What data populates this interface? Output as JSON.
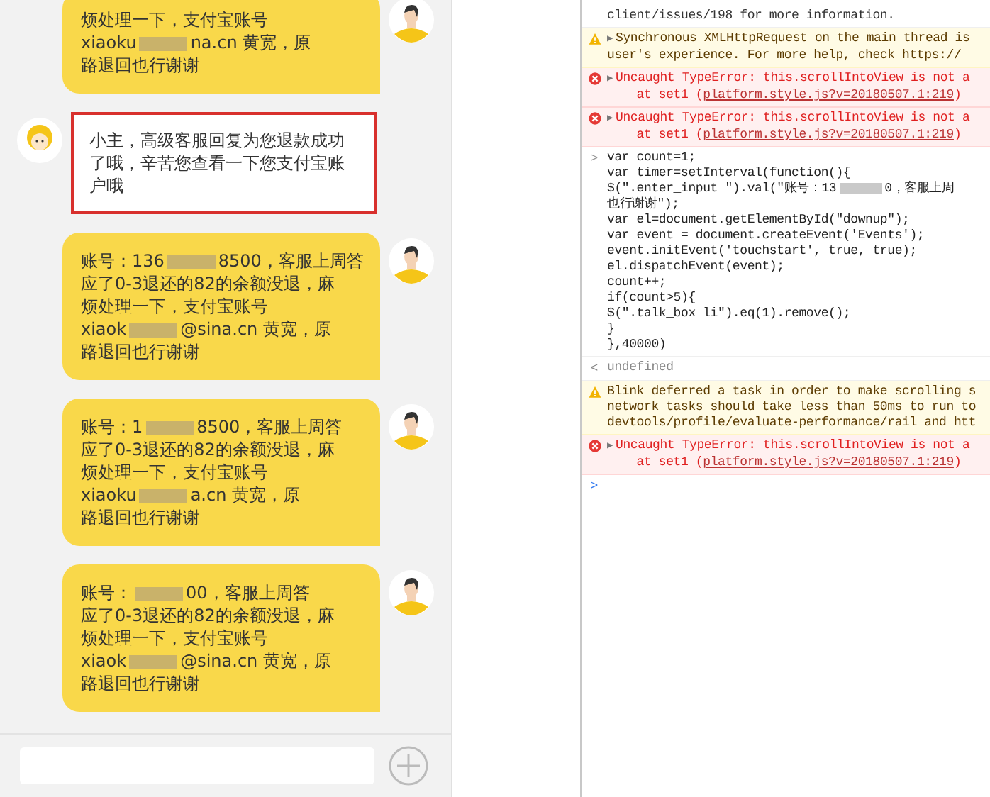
{
  "chat": {
    "messages": [
      {
        "kind": "user",
        "highlighted": false,
        "lines": [
          [
            {
              "kind": "text",
              "text": "烦处理一下，支付宝账号"
            }
          ],
          [
            {
              "kind": "text",
              "text": "xiaoku"
            },
            {
              "kind": "redacted"
            },
            {
              "kind": "text",
              "text": "na.cn 黄宽，原"
            }
          ],
          [
            {
              "kind": "text",
              "text": "路退回也行谢谢"
            }
          ]
        ]
      },
      {
        "kind": "agent",
        "highlighted": true,
        "lines": [
          [
            {
              "kind": "text",
              "text": "小主，高级客服回复为您退款成功"
            }
          ],
          [
            {
              "kind": "text",
              "text": "了哦，辛苦您查看一下您支付宝账"
            }
          ],
          [
            {
              "kind": "text",
              "text": "户哦"
            }
          ]
        ]
      },
      {
        "kind": "user",
        "highlighted": false,
        "lines": [
          [
            {
              "kind": "text",
              "text": "账号：136"
            },
            {
              "kind": "redacted"
            },
            {
              "kind": "text",
              "text": "8500，客服上周答"
            }
          ],
          [
            {
              "kind": "text",
              "text": "应了0-3退还的82的余额没退，麻"
            }
          ],
          [
            {
              "kind": "text",
              "text": "烦处理一下，支付宝账号"
            }
          ],
          [
            {
              "kind": "text",
              "text": "xiaok"
            },
            {
              "kind": "redacted"
            },
            {
              "kind": "text",
              "text": "@sina.cn 黄宽，原"
            }
          ],
          [
            {
              "kind": "text",
              "text": "路退回也行谢谢"
            }
          ]
        ]
      },
      {
        "kind": "user",
        "highlighted": false,
        "lines": [
          [
            {
              "kind": "text",
              "text": "账号：1"
            },
            {
              "kind": "redacted"
            },
            {
              "kind": "text",
              "text": "8500，客服上周答"
            }
          ],
          [
            {
              "kind": "text",
              "text": "应了0-3退还的82的余额没退，麻"
            }
          ],
          [
            {
              "kind": "text",
              "text": "烦处理一下，支付宝账号"
            }
          ],
          [
            {
              "kind": "text",
              "text": "xiaoku"
            },
            {
              "kind": "redacted"
            },
            {
              "kind": "text",
              "text": "a.cn 黄宽，原"
            }
          ],
          [
            {
              "kind": "text",
              "text": "路退回也行谢谢"
            }
          ]
        ]
      },
      {
        "kind": "user",
        "highlighted": false,
        "lines": [
          [
            {
              "kind": "text",
              "text": "账号："
            },
            {
              "kind": "redacted"
            },
            {
              "kind": "text",
              "text": "00，客服上周答"
            }
          ],
          [
            {
              "kind": "text",
              "text": "应了0-3退还的82的余额没退，麻"
            }
          ],
          [
            {
              "kind": "text",
              "text": "烦处理一下，支付宝账号"
            }
          ],
          [
            {
              "kind": "text",
              "text": "xiaok"
            },
            {
              "kind": "redacted"
            },
            {
              "kind": "text",
              "text": "@sina.cn 黄宽，原"
            }
          ],
          [
            {
              "kind": "text",
              "text": "路退回也行谢谢"
            }
          ]
        ]
      }
    ]
  },
  "console": {
    "entries": [
      {
        "kind": "info",
        "lines": [
          [
            {
              "kind": "text",
              "text": "client/issues/198 for more information."
            }
          ]
        ]
      },
      {
        "kind": "warning",
        "arrow": "▶",
        "lines": [
          [
            {
              "kind": "text",
              "text": "Synchronous XMLHttpRequest on the main thread is"
            }
          ],
          [
            {
              "kind": "text",
              "text": "user's experience. For more help, check https://"
            }
          ]
        ]
      },
      {
        "kind": "error",
        "arrow": "▶",
        "lines": [
          [
            {
              "kind": "text",
              "text": "Uncaught TypeError: this.scrollIntoView is not a"
            }
          ],
          [
            {
              "kind": "text",
              "text": "    at set1 ("
            },
            {
              "kind": "link",
              "text": "platform.style.js?v=20180507.1:219"
            },
            {
              "kind": "text",
              "text": ")"
            }
          ]
        ]
      },
      {
        "kind": "error",
        "arrow": "▶",
        "lines": [
          [
            {
              "kind": "text",
              "text": "Uncaught TypeError: this.scrollIntoView is not a"
            }
          ],
          [
            {
              "kind": "text",
              "text": "    at set1 ("
            },
            {
              "kind": "link",
              "text": "platform.style.js?v=20180507.1:219"
            },
            {
              "kind": "text",
              "text": ")"
            }
          ]
        ]
      },
      {
        "kind": "input",
        "marker": ">",
        "lines": [
          [
            {
              "kind": "text",
              "text": "var count=1;"
            }
          ],
          [
            {
              "kind": "text",
              "text": "var timer=setInterval(function(){"
            }
          ],
          [
            {
              "kind": "text",
              "text": "$(\".enter_input \").val(\"账号：13"
            },
            {
              "kind": "redacted"
            },
            {
              "kind": "text",
              "text": "0，客服上周"
            }
          ],
          [
            {
              "kind": "text",
              "text": "也行谢谢\");"
            }
          ],
          [
            {
              "kind": "text",
              "text": "var el=document.getElementById(\"downup\");"
            }
          ],
          [
            {
              "kind": "text",
              "text": "var event = document.createEvent('Events');"
            }
          ],
          [
            {
              "kind": "text",
              "text": "event.initEvent('touchstart', true, true);"
            }
          ],
          [
            {
              "kind": "text",
              "text": "el.dispatchEvent(event);"
            }
          ],
          [
            {
              "kind": "text",
              "text": "count++;"
            }
          ],
          [
            {
              "kind": "text",
              "text": "if(count>5){"
            }
          ],
          [
            {
              "kind": "text",
              "text": "$(\".talk_box li\").eq(1).remove();"
            }
          ],
          [
            {
              "kind": "text",
              "text": "}"
            }
          ],
          [
            {
              "kind": "text",
              "text": "},40000)"
            }
          ]
        ]
      },
      {
        "kind": "output",
        "marker": "<",
        "lines": [
          [
            {
              "kind": "text",
              "text": "undefined"
            }
          ]
        ]
      },
      {
        "kind": "warning",
        "lines": [
          [
            {
              "kind": "text",
              "text": "Blink deferred a task in order to make scrolling s"
            }
          ],
          [
            {
              "kind": "text",
              "text": "network tasks should take less than 50ms to run to"
            }
          ],
          [
            {
              "kind": "text",
              "text": "devtools/profile/evaluate-performance/rail and htt"
            }
          ]
        ]
      },
      {
        "kind": "error",
        "arrow": "▶",
        "lines": [
          [
            {
              "kind": "text",
              "text": "Uncaught TypeError: this.scrollIntoView is not a"
            }
          ],
          [
            {
              "kind": "text",
              "text": "    at set1 ("
            },
            {
              "kind": "link",
              "text": "platform.style.js?v=20180507.1:219"
            },
            {
              "kind": "text",
              "text": ")"
            }
          ]
        ]
      },
      {
        "kind": "prompt",
        "marker": ">"
      }
    ]
  }
}
